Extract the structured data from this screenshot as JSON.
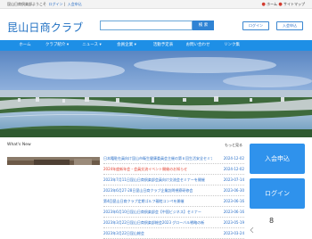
{
  "topbar": {
    "welcome": "昆山日商倶楽部ようこそ",
    "login_link": "ログイン",
    "join_link": "入会申込",
    "home_link": "ホーム",
    "sitemap_link": "サイトマップ"
  },
  "header": {
    "title": "昆山日商クラブ",
    "search_placeholder": "",
    "search_button": "検 索",
    "login_button": "ログイン",
    "join_button": "入会申込"
  },
  "nav": {
    "items": [
      "ホーム",
      "クラブ紹介 ▾",
      "ニュース ▾",
      "会員企業 ▾",
      "活動予定表",
      "お問い合わせ",
      "リンク集"
    ]
  },
  "news": {
    "title": "What's New",
    "more": "もっと見る",
    "items": [
      {
        "title": "日本籍駐在員向け昆山市衛生健康委員会主催の第６回生活安全セミナー",
        "date": "2024-12-02",
        "highlight": false
      },
      {
        "title": "2024年度新年会・会員交流イベント開催のお知らせ",
        "date": "2024-12-02",
        "highlight": true
      },
      {
        "title": "2023年7月11日昆山日商倶楽部会員向け交流会セミナーを開催",
        "date": "2023-07-14",
        "highlight": false
      },
      {
        "title": "2023年6月27-28日昆山日商クラブ企業訪問視察研修会",
        "date": "2023-06-30",
        "highlight": false
      },
      {
        "title": "第4回昆山日商クラブ定期ゴルフ親睦コンペを開催",
        "date": "2023-06-16",
        "highlight": false
      },
      {
        "title": "2023年6月10日昆山日商倶楽部会【中国ビジネス】セミナー",
        "date": "2023-06-16",
        "highlight": false
      },
      {
        "title": "2023年3月22日昆山日商倶楽部総会2023 グローバル戦略の新",
        "date": "2023-05-19",
        "highlight": false
      },
      {
        "title": "2023年3月22日昆山総会",
        "date": "2023-03-24",
        "highlight": false
      }
    ]
  },
  "sidebar": {
    "join_button": "入会申込",
    "login_button": "ログイン",
    "counter": "8"
  },
  "colors": {
    "brand_blue": "#1e8fe6",
    "button_blue": "#2f92ec",
    "link_blue": "#2a6fc8",
    "highlight_red": "#e2402f"
  }
}
